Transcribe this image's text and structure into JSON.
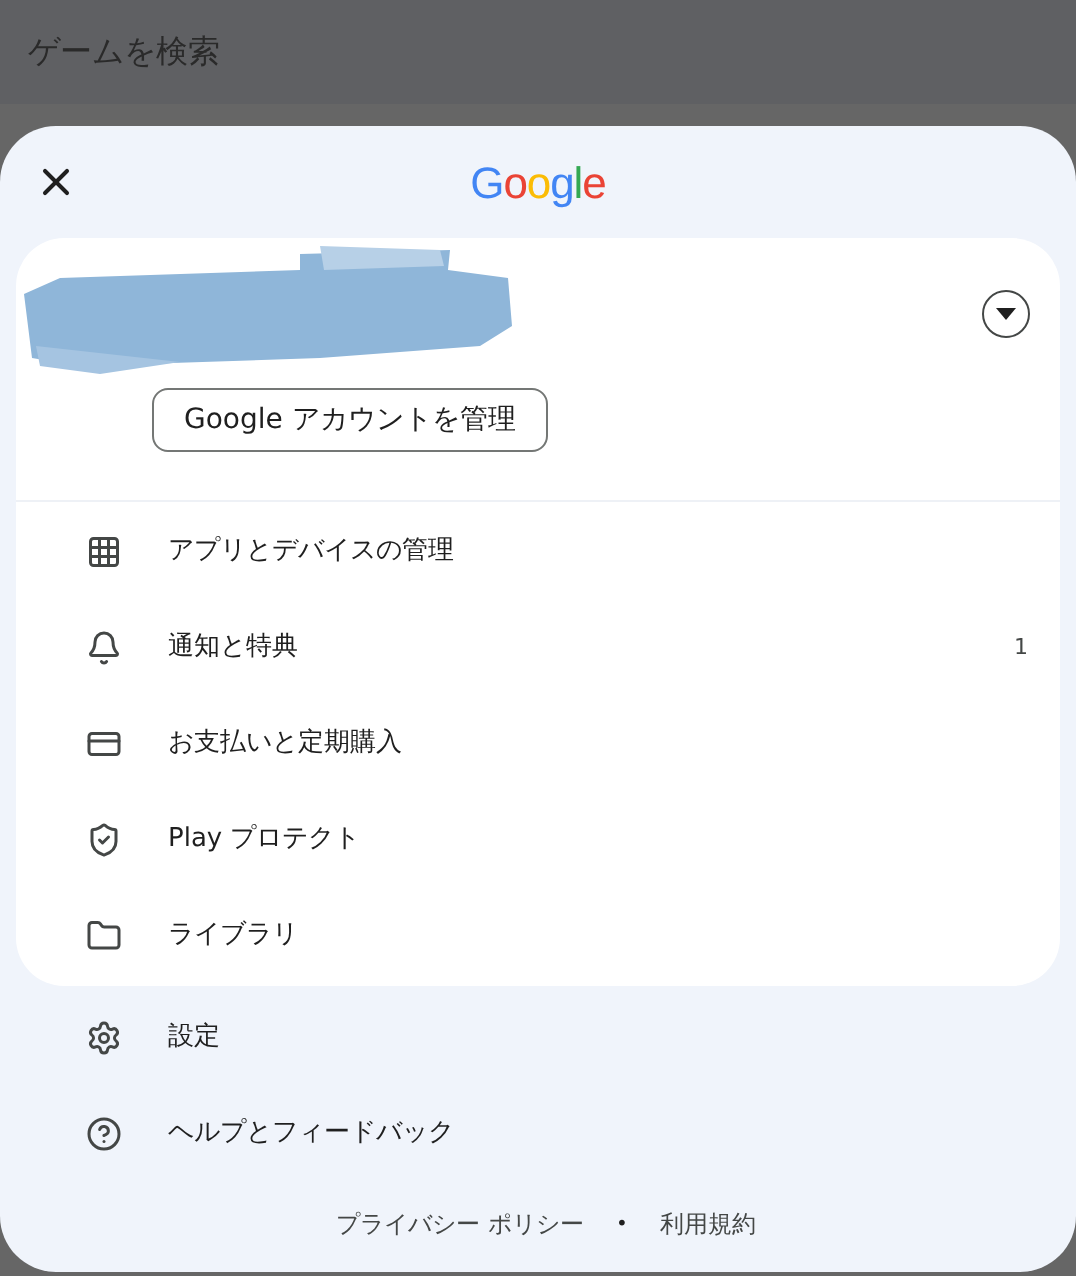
{
  "search_bar": {
    "placeholder": "ゲームを検索"
  },
  "sheet": {
    "logo": "Google",
    "account": {
      "manage_button": "Google アカウントを管理"
    },
    "menu": [
      {
        "label": "アプリとデバイスの管理"
      },
      {
        "label": "通知と特典",
        "badge": "1"
      },
      {
        "label": "お支払いと定期購入"
      },
      {
        "label": "Play プロテクト"
      },
      {
        "label": "ライブラリ"
      }
    ],
    "more_menu": [
      {
        "label": "設定"
      },
      {
        "label": "ヘルプとフィードバック"
      }
    ],
    "footer": {
      "links": [
        "プライバシー ポリシー",
        "利用規約"
      ],
      "separator": "•"
    }
  }
}
